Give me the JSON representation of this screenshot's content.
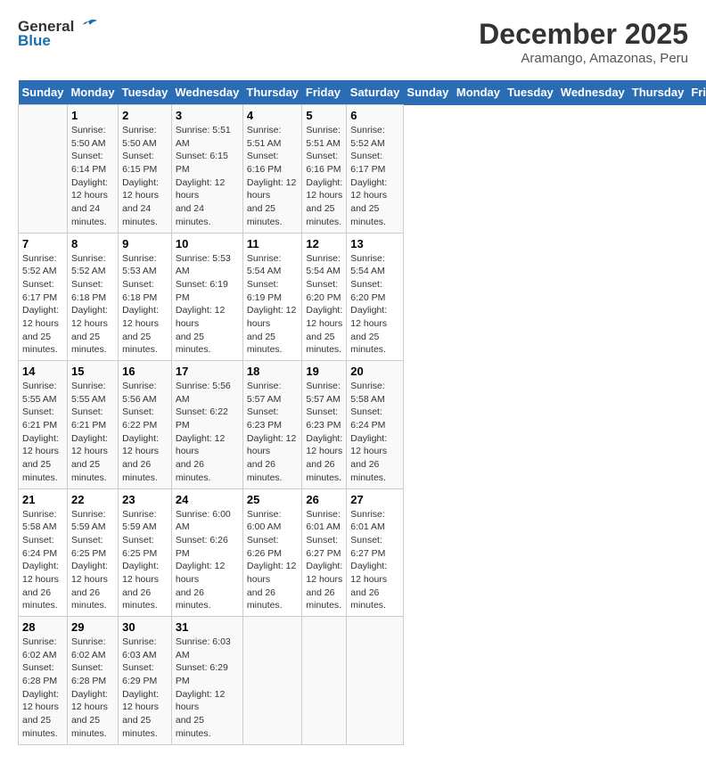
{
  "logo": {
    "general": "General",
    "blue": "Blue"
  },
  "title": "December 2025",
  "location": "Aramango, Amazonas, Peru",
  "days_of_week": [
    "Sunday",
    "Monday",
    "Tuesday",
    "Wednesday",
    "Thursday",
    "Friday",
    "Saturday"
  ],
  "weeks": [
    [
      {
        "day": "",
        "info": ""
      },
      {
        "day": "1",
        "info": "Sunrise: 5:50 AM\nSunset: 6:14 PM\nDaylight: 12 hours\nand 24 minutes."
      },
      {
        "day": "2",
        "info": "Sunrise: 5:50 AM\nSunset: 6:15 PM\nDaylight: 12 hours\nand 24 minutes."
      },
      {
        "day": "3",
        "info": "Sunrise: 5:51 AM\nSunset: 6:15 PM\nDaylight: 12 hours\nand 24 minutes."
      },
      {
        "day": "4",
        "info": "Sunrise: 5:51 AM\nSunset: 6:16 PM\nDaylight: 12 hours\nand 25 minutes."
      },
      {
        "day": "5",
        "info": "Sunrise: 5:51 AM\nSunset: 6:16 PM\nDaylight: 12 hours\nand 25 minutes."
      },
      {
        "day": "6",
        "info": "Sunrise: 5:52 AM\nSunset: 6:17 PM\nDaylight: 12 hours\nand 25 minutes."
      }
    ],
    [
      {
        "day": "7",
        "info": "Sunrise: 5:52 AM\nSunset: 6:17 PM\nDaylight: 12 hours\nand 25 minutes."
      },
      {
        "day": "8",
        "info": "Sunrise: 5:52 AM\nSunset: 6:18 PM\nDaylight: 12 hours\nand 25 minutes."
      },
      {
        "day": "9",
        "info": "Sunrise: 5:53 AM\nSunset: 6:18 PM\nDaylight: 12 hours\nand 25 minutes."
      },
      {
        "day": "10",
        "info": "Sunrise: 5:53 AM\nSunset: 6:19 PM\nDaylight: 12 hours\nand 25 minutes."
      },
      {
        "day": "11",
        "info": "Sunrise: 5:54 AM\nSunset: 6:19 PM\nDaylight: 12 hours\nand 25 minutes."
      },
      {
        "day": "12",
        "info": "Sunrise: 5:54 AM\nSunset: 6:20 PM\nDaylight: 12 hours\nand 25 minutes."
      },
      {
        "day": "13",
        "info": "Sunrise: 5:54 AM\nSunset: 6:20 PM\nDaylight: 12 hours\nand 25 minutes."
      }
    ],
    [
      {
        "day": "14",
        "info": "Sunrise: 5:55 AM\nSunset: 6:21 PM\nDaylight: 12 hours\nand 25 minutes."
      },
      {
        "day": "15",
        "info": "Sunrise: 5:55 AM\nSunset: 6:21 PM\nDaylight: 12 hours\nand 25 minutes."
      },
      {
        "day": "16",
        "info": "Sunrise: 5:56 AM\nSunset: 6:22 PM\nDaylight: 12 hours\nand 26 minutes."
      },
      {
        "day": "17",
        "info": "Sunrise: 5:56 AM\nSunset: 6:22 PM\nDaylight: 12 hours\nand 26 minutes."
      },
      {
        "day": "18",
        "info": "Sunrise: 5:57 AM\nSunset: 6:23 PM\nDaylight: 12 hours\nand 26 minutes."
      },
      {
        "day": "19",
        "info": "Sunrise: 5:57 AM\nSunset: 6:23 PM\nDaylight: 12 hours\nand 26 minutes."
      },
      {
        "day": "20",
        "info": "Sunrise: 5:58 AM\nSunset: 6:24 PM\nDaylight: 12 hours\nand 26 minutes."
      }
    ],
    [
      {
        "day": "21",
        "info": "Sunrise: 5:58 AM\nSunset: 6:24 PM\nDaylight: 12 hours\nand 26 minutes."
      },
      {
        "day": "22",
        "info": "Sunrise: 5:59 AM\nSunset: 6:25 PM\nDaylight: 12 hours\nand 26 minutes."
      },
      {
        "day": "23",
        "info": "Sunrise: 5:59 AM\nSunset: 6:25 PM\nDaylight: 12 hours\nand 26 minutes."
      },
      {
        "day": "24",
        "info": "Sunrise: 6:00 AM\nSunset: 6:26 PM\nDaylight: 12 hours\nand 26 minutes."
      },
      {
        "day": "25",
        "info": "Sunrise: 6:00 AM\nSunset: 6:26 PM\nDaylight: 12 hours\nand 26 minutes."
      },
      {
        "day": "26",
        "info": "Sunrise: 6:01 AM\nSunset: 6:27 PM\nDaylight: 12 hours\nand 26 minutes."
      },
      {
        "day": "27",
        "info": "Sunrise: 6:01 AM\nSunset: 6:27 PM\nDaylight: 12 hours\nand 26 minutes."
      }
    ],
    [
      {
        "day": "28",
        "info": "Sunrise: 6:02 AM\nSunset: 6:28 PM\nDaylight: 12 hours\nand 25 minutes."
      },
      {
        "day": "29",
        "info": "Sunrise: 6:02 AM\nSunset: 6:28 PM\nDaylight: 12 hours\nand 25 minutes."
      },
      {
        "day": "30",
        "info": "Sunrise: 6:03 AM\nSunset: 6:29 PM\nDaylight: 12 hours\nand 25 minutes."
      },
      {
        "day": "31",
        "info": "Sunrise: 6:03 AM\nSunset: 6:29 PM\nDaylight: 12 hours\nand 25 minutes."
      },
      {
        "day": "",
        "info": ""
      },
      {
        "day": "",
        "info": ""
      },
      {
        "day": "",
        "info": ""
      }
    ]
  ]
}
